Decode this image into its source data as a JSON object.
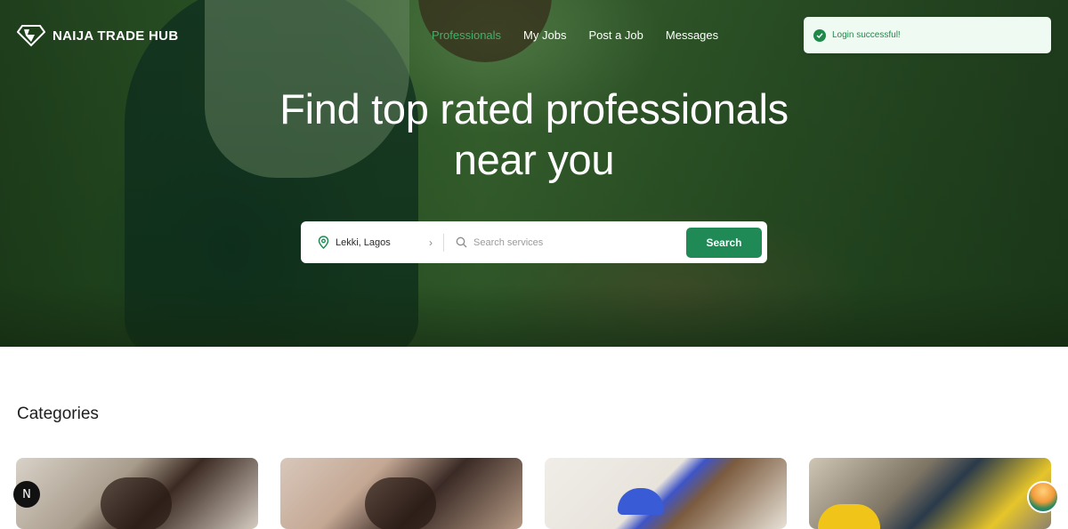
{
  "brand": {
    "name": "NAIJA TRADE HUB",
    "logo_icon": "diamond-icon"
  },
  "nav": {
    "items": [
      {
        "label": "Professionals",
        "active": true
      },
      {
        "label": "My Jobs",
        "active": false
      },
      {
        "label": "Post a Job",
        "active": false
      },
      {
        "label": "Messages",
        "active": false
      }
    ]
  },
  "toast": {
    "message": "Login successful!",
    "icon": "check-circle-icon"
  },
  "hero": {
    "headline_line1": "Find top rated professionals",
    "headline_line2": "near you"
  },
  "search": {
    "location": "Lekki, Lagos",
    "location_icon": "map-pin-icon",
    "services_placeholder": "Search services",
    "services_value": "",
    "button_label": "Search"
  },
  "categories": {
    "title": "Categories"
  },
  "badges": {
    "dev_badge": "N"
  },
  "colors": {
    "accent": "#1f8a56",
    "active_nav": "#3fb26b",
    "toast_bg": "#effaf2"
  }
}
